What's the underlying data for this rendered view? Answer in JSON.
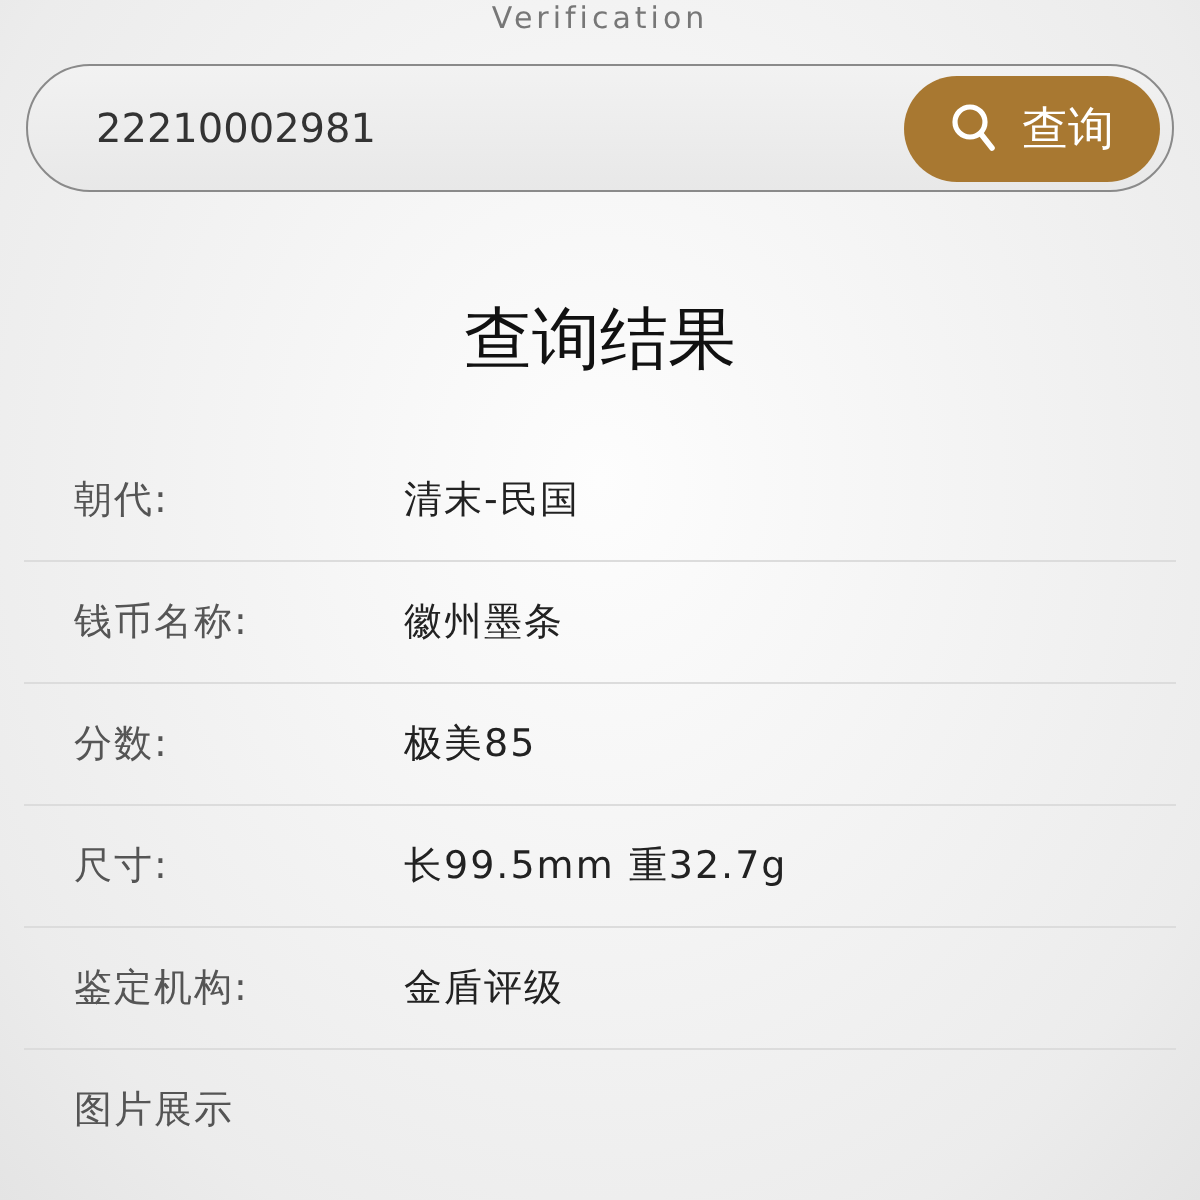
{
  "header": {
    "subtitle": "Verification"
  },
  "search": {
    "value": "22210002981",
    "button": "查询"
  },
  "result": {
    "title": "查询结果",
    "rows": [
      {
        "label": "朝代:",
        "value": "清末-民国"
      },
      {
        "label": "钱币名称:",
        "value": "徽州墨条"
      },
      {
        "label": "分数:",
        "value": "极美85"
      },
      {
        "label": "尺寸:",
        "value": "长99.5mm 重32.7g"
      },
      {
        "label": "鉴定机构:",
        "value": "金盾评级"
      }
    ],
    "gallery_label": "图片展示"
  }
}
